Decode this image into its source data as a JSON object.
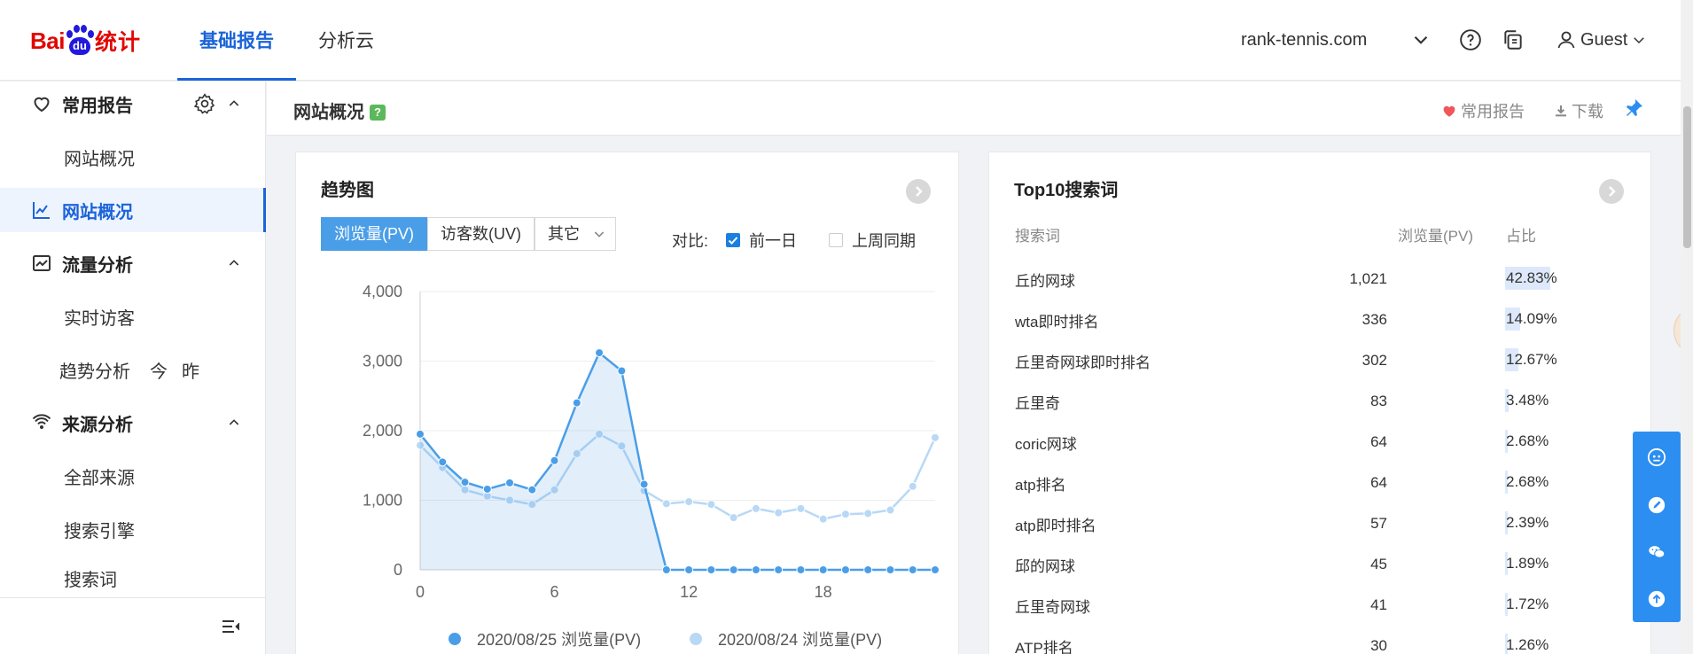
{
  "header": {
    "logo_bai": "Bai",
    "logo_du": "du",
    "logo_tongji": "统计",
    "tabs": [
      {
        "label": "基础报告",
        "active": true
      },
      {
        "label": "分析云",
        "active": false
      }
    ],
    "domain": "rank-tennis.com",
    "user": "Guest"
  },
  "sidebar": {
    "items": [
      {
        "label": "常用报告",
        "kind": "group"
      },
      {
        "label": "网站概况",
        "kind": "sub"
      },
      {
        "label": "网站概况",
        "kind": "active"
      },
      {
        "label": "流量分析",
        "kind": "group"
      },
      {
        "label": "实时访客",
        "kind": "sub"
      },
      {
        "label": "趋势分析",
        "kind": "sub",
        "extra1": "今",
        "extra2": "昨"
      },
      {
        "label": "来源分析",
        "kind": "group"
      },
      {
        "label": "全部来源",
        "kind": "sub"
      },
      {
        "label": "搜索引擎",
        "kind": "sub"
      },
      {
        "label": "搜索词",
        "kind": "sub"
      }
    ]
  },
  "pagebar": {
    "title": "网站概况",
    "help": "?",
    "fav": "常用报告",
    "download": "下载"
  },
  "trend": {
    "title": "趋势图",
    "metrics": [
      "浏览量(PV)",
      "访客数(UV)",
      "其它"
    ],
    "compare_label": "对比:",
    "compare_options": [
      {
        "label": "前一日",
        "checked": true
      },
      {
        "label": "上周同期",
        "checked": false
      }
    ]
  },
  "chart_data": {
    "type": "line",
    "x": [
      0,
      1,
      2,
      3,
      4,
      5,
      6,
      7,
      8,
      9,
      10,
      11,
      12,
      13,
      14,
      15,
      16,
      17,
      18,
      19,
      20,
      21,
      22,
      23
    ],
    "xticks": [
      "0",
      "6",
      "12",
      "18"
    ],
    "yticks": [
      "0",
      "1,000",
      "2,000",
      "3,000",
      "4,000"
    ],
    "ylim": [
      0,
      4000
    ],
    "grid": true,
    "legend_position": "bottom",
    "series": [
      {
        "name": "2020/08/25 浏览量(PV)",
        "color": "#4a9ee8",
        "area": true,
        "values": [
          1950,
          1550,
          1260,
          1160,
          1250,
          1150,
          1570,
          2400,
          3120,
          2860,
          1230,
          0,
          0,
          0,
          0,
          0,
          0,
          0,
          0,
          0,
          0,
          0,
          0,
          0
        ]
      },
      {
        "name": "2020/08/24 浏览量(PV)",
        "color": "#b8d8f6",
        "area": false,
        "values": [
          1790,
          1470,
          1150,
          1060,
          1000,
          940,
          1150,
          1670,
          1950,
          1780,
          1140,
          950,
          980,
          940,
          750,
          880,
          820,
          880,
          730,
          800,
          810,
          860,
          1200,
          1900
        ]
      }
    ]
  },
  "keywords": {
    "title": "Top10搜索词",
    "headers": [
      "搜索词",
      "浏览量(PV)",
      "占比"
    ],
    "rows": [
      {
        "word": "丘的网球",
        "pv": "1,021",
        "pct": "42.83%",
        "ratio": 0.4283
      },
      {
        "word": "wta即时排名",
        "pv": "336",
        "pct": "14.09%",
        "ratio": 0.1409
      },
      {
        "word": "丘里奇网球即时排名",
        "pv": "302",
        "pct": "12.67%",
        "ratio": 0.1267
      },
      {
        "word": "丘里奇",
        "pv": "83",
        "pct": "3.48%",
        "ratio": 0.0348
      },
      {
        "word": "coric网球",
        "pv": "64",
        "pct": "2.68%",
        "ratio": 0.0268
      },
      {
        "word": "atp排名",
        "pv": "64",
        "pct": "2.68%",
        "ratio": 0.0268
      },
      {
        "word": "atp即时排名",
        "pv": "57",
        "pct": "2.39%",
        "ratio": 0.0239
      },
      {
        "word": "邱的网球",
        "pv": "45",
        "pct": "1.89%",
        "ratio": 0.0189
      },
      {
        "word": "丘里奇网球",
        "pv": "41",
        "pct": "1.72%",
        "ratio": 0.0172
      },
      {
        "word": "ATP排名",
        "pv": "30",
        "pct": "1.26%",
        "ratio": 0.0126
      }
    ]
  }
}
